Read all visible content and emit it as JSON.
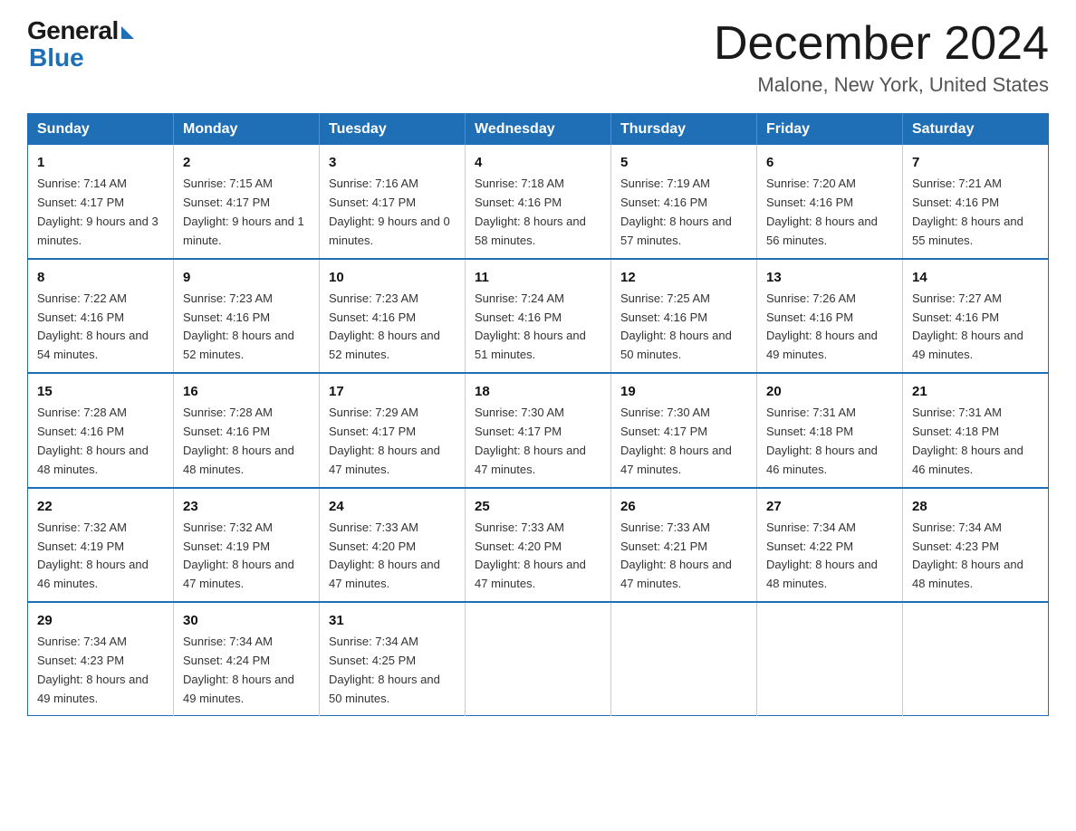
{
  "header": {
    "logo_general": "General",
    "logo_blue": "Blue",
    "month": "December 2024",
    "location": "Malone, New York, United States"
  },
  "days_of_week": [
    "Sunday",
    "Monday",
    "Tuesday",
    "Wednesday",
    "Thursday",
    "Friday",
    "Saturday"
  ],
  "weeks": [
    [
      {
        "day": "1",
        "sunrise": "7:14 AM",
        "sunset": "4:17 PM",
        "daylight": "9 hours and 3 minutes."
      },
      {
        "day": "2",
        "sunrise": "7:15 AM",
        "sunset": "4:17 PM",
        "daylight": "9 hours and 1 minute."
      },
      {
        "day": "3",
        "sunrise": "7:16 AM",
        "sunset": "4:17 PM",
        "daylight": "9 hours and 0 minutes."
      },
      {
        "day": "4",
        "sunrise": "7:18 AM",
        "sunset": "4:16 PM",
        "daylight": "8 hours and 58 minutes."
      },
      {
        "day": "5",
        "sunrise": "7:19 AM",
        "sunset": "4:16 PM",
        "daylight": "8 hours and 57 minutes."
      },
      {
        "day": "6",
        "sunrise": "7:20 AM",
        "sunset": "4:16 PM",
        "daylight": "8 hours and 56 minutes."
      },
      {
        "day": "7",
        "sunrise": "7:21 AM",
        "sunset": "4:16 PM",
        "daylight": "8 hours and 55 minutes."
      }
    ],
    [
      {
        "day": "8",
        "sunrise": "7:22 AM",
        "sunset": "4:16 PM",
        "daylight": "8 hours and 54 minutes."
      },
      {
        "day": "9",
        "sunrise": "7:23 AM",
        "sunset": "4:16 PM",
        "daylight": "8 hours and 52 minutes."
      },
      {
        "day": "10",
        "sunrise": "7:23 AM",
        "sunset": "4:16 PM",
        "daylight": "8 hours and 52 minutes."
      },
      {
        "day": "11",
        "sunrise": "7:24 AM",
        "sunset": "4:16 PM",
        "daylight": "8 hours and 51 minutes."
      },
      {
        "day": "12",
        "sunrise": "7:25 AM",
        "sunset": "4:16 PM",
        "daylight": "8 hours and 50 minutes."
      },
      {
        "day": "13",
        "sunrise": "7:26 AM",
        "sunset": "4:16 PM",
        "daylight": "8 hours and 49 minutes."
      },
      {
        "day": "14",
        "sunrise": "7:27 AM",
        "sunset": "4:16 PM",
        "daylight": "8 hours and 49 minutes."
      }
    ],
    [
      {
        "day": "15",
        "sunrise": "7:28 AM",
        "sunset": "4:16 PM",
        "daylight": "8 hours and 48 minutes."
      },
      {
        "day": "16",
        "sunrise": "7:28 AM",
        "sunset": "4:16 PM",
        "daylight": "8 hours and 48 minutes."
      },
      {
        "day": "17",
        "sunrise": "7:29 AM",
        "sunset": "4:17 PM",
        "daylight": "8 hours and 47 minutes."
      },
      {
        "day": "18",
        "sunrise": "7:30 AM",
        "sunset": "4:17 PM",
        "daylight": "8 hours and 47 minutes."
      },
      {
        "day": "19",
        "sunrise": "7:30 AM",
        "sunset": "4:17 PM",
        "daylight": "8 hours and 47 minutes."
      },
      {
        "day": "20",
        "sunrise": "7:31 AM",
        "sunset": "4:18 PM",
        "daylight": "8 hours and 46 minutes."
      },
      {
        "day": "21",
        "sunrise": "7:31 AM",
        "sunset": "4:18 PM",
        "daylight": "8 hours and 46 minutes."
      }
    ],
    [
      {
        "day": "22",
        "sunrise": "7:32 AM",
        "sunset": "4:19 PM",
        "daylight": "8 hours and 46 minutes."
      },
      {
        "day": "23",
        "sunrise": "7:32 AM",
        "sunset": "4:19 PM",
        "daylight": "8 hours and 47 minutes."
      },
      {
        "day": "24",
        "sunrise": "7:33 AM",
        "sunset": "4:20 PM",
        "daylight": "8 hours and 47 minutes."
      },
      {
        "day": "25",
        "sunrise": "7:33 AM",
        "sunset": "4:20 PM",
        "daylight": "8 hours and 47 minutes."
      },
      {
        "day": "26",
        "sunrise": "7:33 AM",
        "sunset": "4:21 PM",
        "daylight": "8 hours and 47 minutes."
      },
      {
        "day": "27",
        "sunrise": "7:34 AM",
        "sunset": "4:22 PM",
        "daylight": "8 hours and 48 minutes."
      },
      {
        "day": "28",
        "sunrise": "7:34 AM",
        "sunset": "4:23 PM",
        "daylight": "8 hours and 48 minutes."
      }
    ],
    [
      {
        "day": "29",
        "sunrise": "7:34 AM",
        "sunset": "4:23 PM",
        "daylight": "8 hours and 49 minutes."
      },
      {
        "day": "30",
        "sunrise": "7:34 AM",
        "sunset": "4:24 PM",
        "daylight": "8 hours and 49 minutes."
      },
      {
        "day": "31",
        "sunrise": "7:34 AM",
        "sunset": "4:25 PM",
        "daylight": "8 hours and 50 minutes."
      },
      null,
      null,
      null,
      null
    ]
  ]
}
